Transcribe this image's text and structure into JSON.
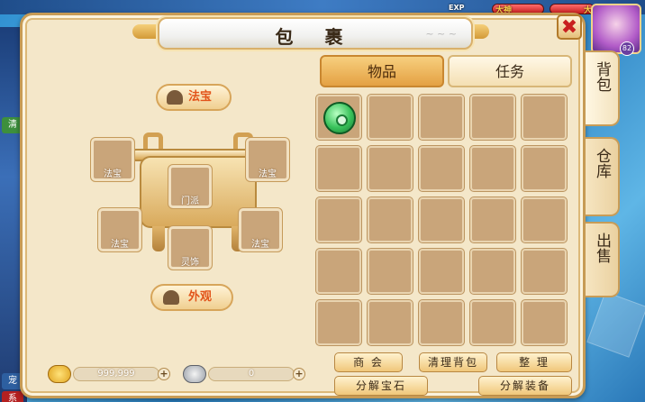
{
  "window": {
    "title": "包 裹",
    "close_label": "✖"
  },
  "player": {
    "name_tag_1": "大神",
    "name_tag_2": "大神",
    "exp_label": "EXP",
    "level": "82"
  },
  "left_tags": [
    "清",
    "宠",
    "系"
  ],
  "equipment": {
    "header_label": "法宝",
    "footer_label": "外观",
    "slots": [
      {
        "label": "法宝"
      },
      {
        "label": "法宝"
      },
      {
        "label": "门派"
      },
      {
        "label": "法宝"
      },
      {
        "label": "法宝"
      },
      {
        "label": "灵饰"
      }
    ]
  },
  "currency": {
    "gold_value": "999,999",
    "silver_value": "0",
    "plus_label": "+"
  },
  "tabs": [
    {
      "label": "物品",
      "active": true
    },
    {
      "label": "任务",
      "active": false
    }
  ],
  "inventory": {
    "rows": 5,
    "cols": 5,
    "items": [
      {
        "index": 0,
        "icon": "jade-pendant-icon"
      }
    ]
  },
  "side_tabs": [
    {
      "label": "背包",
      "active": true
    },
    {
      "label": "仓库",
      "active": false
    },
    {
      "label": "出售",
      "active": false
    }
  ],
  "buttons": {
    "shop": "商 会",
    "clean": "清理背包",
    "sort": "整 理",
    "decompose_gem": "分解宝石",
    "decompose_equip": "分解装备"
  },
  "colors": {
    "panel_bg": "#f4e7c9",
    "tab_active": "#e4a143",
    "close_x": "#c81f1f",
    "accent_text": "#e2541a"
  }
}
